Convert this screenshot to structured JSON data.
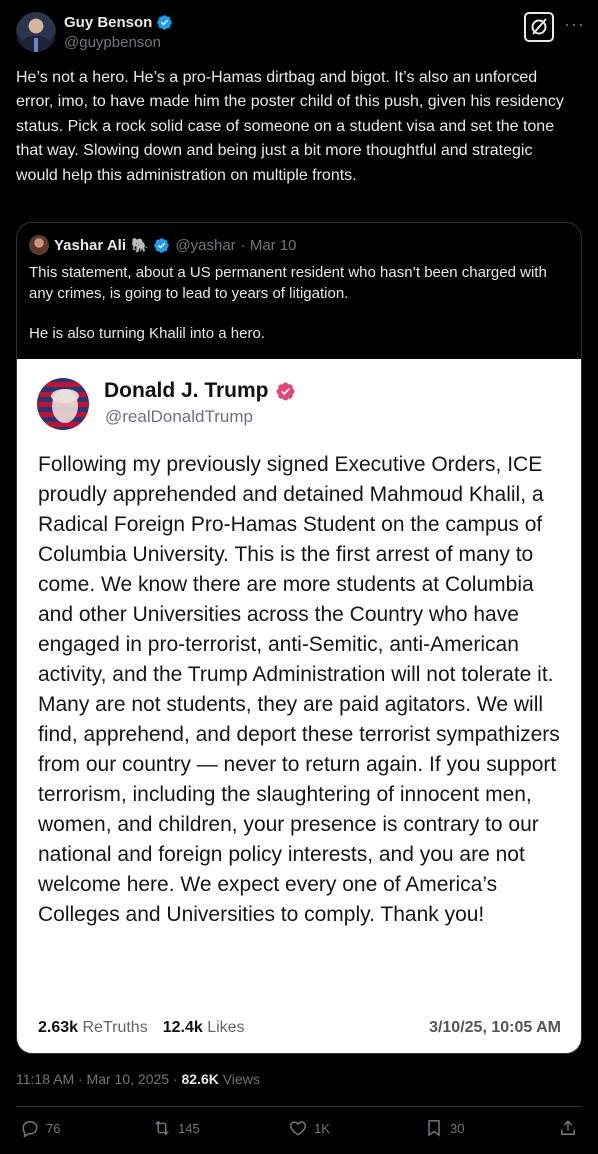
{
  "author": {
    "name": "Guy Benson",
    "handle": "@guypbenson"
  },
  "tweet": {
    "text": "He’s not a hero. He’s a pro-Hamas dirtbag and bigot. It’s also an unforced error, imo, to have made him the poster child of this push, given his residency status. Pick a rock solid case of someone on a student visa and set the tone that way. Slowing down and being just a bit more thoughtful and strategic would help this administration on multiple fronts."
  },
  "quote": {
    "name": "Yashar Ali",
    "emoji": "🐘",
    "handle": "@yashar",
    "date": "· Mar 10",
    "paragraph1": "This statement, about a US permanent resident who hasn’t been charged with any crimes, is going to lead to years of litigation.",
    "paragraph2": "He is also turning Khalil into a hero."
  },
  "embedded_post": {
    "name": "Donald J. Trump",
    "handle": "@realDonaldTrump",
    "body": "Following my previously signed Executive Orders, ICE proudly apprehended and detained Mahmoud Khalil, a Radical Foreign Pro-Hamas Student on the campus of Columbia University. This is the first arrest of many to come. We know there are more students at Columbia and other Universities across the Country who have engaged in pro-terrorist, anti-Semitic, anti-American activity, and the Trump Administration will not tolerate it. Many are not students, they are paid agitators. We will find, apprehend, and deport these terrorist sympathizers from our country — never to return again. If you support terrorism, including the slaughtering of innocent men, women, and children, your presence is contrary to our national and foreign policy interests, and you are not welcome here. We expect every one of America’s Colleges and Universities to comply. Thank you!",
    "retruths_count": "2.63k",
    "retruths_label": "ReTruths",
    "likes_count": "12.4k",
    "likes_label": "Likes",
    "timestamp": "3/10/25, 10:05 AM"
  },
  "meta": {
    "time": "11:18 AM · Mar 10, 2025 ·",
    "views_count": "82.6K",
    "views_label": "Views"
  },
  "actions": {
    "replies": "76",
    "reposts": "145",
    "likes": "1K",
    "bookmarks": "30"
  },
  "colors": {
    "background": "#000000",
    "verified_blue": "#1d9bf0",
    "truth_verified": "#e0457b",
    "muted": "#71767b"
  }
}
